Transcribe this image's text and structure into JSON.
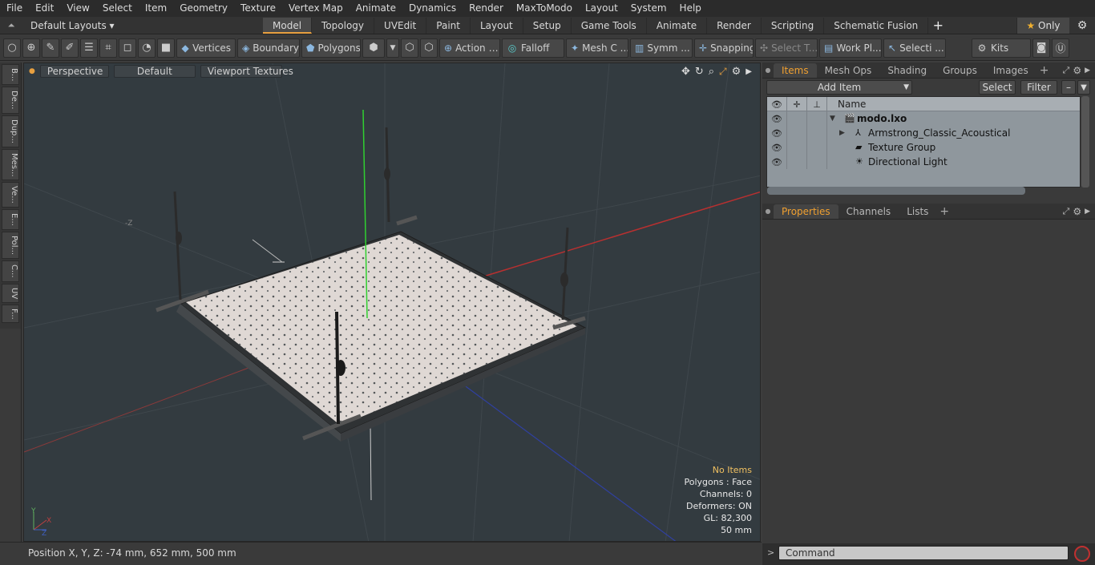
{
  "menu": [
    "File",
    "Edit",
    "View",
    "Select",
    "Item",
    "Geometry",
    "Texture",
    "Vertex Map",
    "Animate",
    "Dynamics",
    "Render",
    "MaxToModo",
    "Layout",
    "System",
    "Help"
  ],
  "layout_selector": "Default Layouts",
  "tabs": [
    "Model",
    "Topology",
    "UVEdit",
    "Paint",
    "Layout",
    "Setup",
    "Game Tools",
    "Animate",
    "Render",
    "Scripting",
    "Schematic Fusion"
  ],
  "only_label": "Only",
  "toolbar": {
    "vertices": "Vertices",
    "boundary": "Boundary",
    "polygons": "Polygons",
    "action": "Action",
    "falloff": "Falloff",
    "mesh": "Mesh C ...",
    "symm": "Symm ...",
    "snapping": "Snapping",
    "select_t": "Select T...",
    "workpl": "Work Pl...",
    "selecti": "Selecti ...",
    "kits": "Kits"
  },
  "left_tabs": [
    "B...",
    "De...",
    "Dup...",
    "Mes...",
    "Ve...",
    "E...",
    "Pol...",
    "C...",
    "UV",
    "F..."
  ],
  "viewport": {
    "perspective": "Perspective",
    "default": "Default",
    "textures": "Viewport Textures",
    "axis_label": "-Z",
    "info": [
      "No Items",
      "Polygons : Face",
      "Channels: 0",
      "Deformers: ON",
      "GL: 82,300",
      "50 mm"
    ]
  },
  "status": "Position X, Y, Z:   -74 mm, 652 mm, 500 mm",
  "panel_tabs": [
    "Items",
    "Mesh Ops",
    "Shading",
    "Groups",
    "Images"
  ],
  "add_item": "Add Item",
  "select_btn": "Select",
  "filter_btn": "Filter",
  "tree": {
    "name_header": "Name",
    "items": [
      {
        "name": "modo.lxo",
        "level": 0,
        "bold": true
      },
      {
        "name": "Armstrong_Classic_Acoustical",
        "level": 1,
        "bold": false
      },
      {
        "name": "Texture Group",
        "level": 1,
        "bold": false
      },
      {
        "name": "Directional Light",
        "level": 1,
        "bold": false
      }
    ]
  },
  "props_tabs": [
    "Properties",
    "Channels",
    "Lists"
  ],
  "command_placeholder": "Command"
}
